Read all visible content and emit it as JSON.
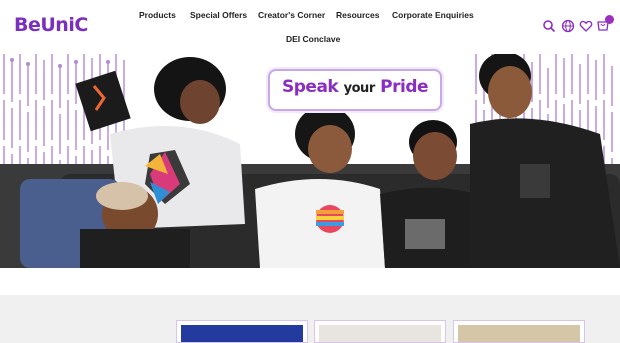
{
  "brand": {
    "logo_text": "BeUniC"
  },
  "nav": {
    "products": "Products",
    "special_offers": "Special Offers",
    "creators_corner": "Creator's Corner",
    "resources": "Resources",
    "corporate_enquiries": "Corporate Enquiries",
    "dei_conclave": "DEI Conclave"
  },
  "icons": {
    "search": "search-icon",
    "globe": "globe-icon",
    "wishlist": "heart-icon",
    "cart": "cart-icon"
  },
  "hero": {
    "banner_word1": "Speak",
    "banner_word2": "your",
    "banner_word3": "Pride"
  },
  "colors": {
    "accent": "#8a2ec2",
    "stripe": "#b488d8"
  }
}
